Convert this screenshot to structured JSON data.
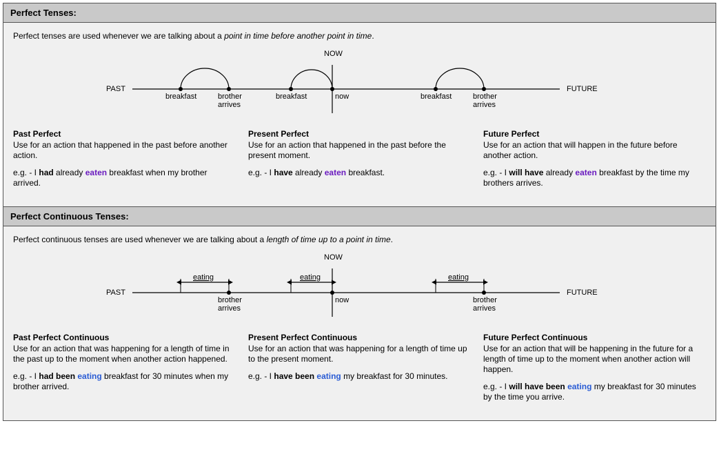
{
  "perfect": {
    "title": "Perfect Tenses:",
    "intro_plain": "Perfect tenses are used whenever we are talking about a ",
    "intro_italic": "point in time before another point in time",
    "intro_end": ".",
    "diagram": {
      "now": "NOW",
      "past": "PAST",
      "future": "FUTURE",
      "seg1_a": "breakfast",
      "seg1_b1": "brother",
      "seg1_b2": "arrives",
      "seg2_a": "breakfast",
      "seg2_b": "now",
      "seg3_a": "breakfast",
      "seg3_b1": "brother",
      "seg3_b2": "arrives"
    },
    "cols": {
      "past": {
        "title": "Past Perfect",
        "desc": "Use for an action that happened in the past before another action.",
        "eg_pre": "e.g. - I ",
        "eg_aux": "had",
        "eg_mid": " already ",
        "eg_verb": "eaten",
        "eg_post": " breakfast when my brother arrived."
      },
      "present": {
        "title": "Present Perfect",
        "desc": "Use for an action that happened in the past before the present moment.",
        "eg_pre": "e.g. - I ",
        "eg_aux": "have",
        "eg_mid": " already ",
        "eg_verb": "eaten",
        "eg_post": " breakfast."
      },
      "future": {
        "title": "Future Perfect",
        "desc": "Use for an action that will happen in the future before another action.",
        "eg_pre": "e.g. - I ",
        "eg_aux": "will have",
        "eg_mid": " already ",
        "eg_verb": "eaten",
        "eg_post": " breakfast by the time my brothers arrives."
      }
    }
  },
  "perfcont": {
    "title": "Perfect Continuous Tenses:",
    "intro_plain": "Perfect continuous tenses are used whenever we are talking about a ",
    "intro_italic": "length of time up to a point in time",
    "intro_end": ".",
    "diagram": {
      "now": "NOW",
      "past": "PAST",
      "future": "FUTURE",
      "span_label": "eating",
      "seg1_b1": "brother",
      "seg1_b2": "arrives",
      "seg2_b": "now",
      "seg3_b1": "brother",
      "seg3_b2": "arrives"
    },
    "cols": {
      "past": {
        "title": "Past Perfect Continuous",
        "desc": "Use for an action that was happening for a length of time in the past up to the moment when another action happened.",
        "eg_pre": "e.g. - I ",
        "eg_aux": "had been ",
        "eg_verb": "eating",
        "eg_post": " breakfast for 30 minutes when my brother arrived."
      },
      "present": {
        "title": "Present Perfect Continuous",
        "desc": "Use for an action that was happening for a length of time up to the present moment.",
        "eg_pre": "e.g. - I ",
        "eg_aux": "have been ",
        "eg_verb": "eating",
        "eg_post": " my breakfast for 30 minutes."
      },
      "future": {
        "title": "Future Perfect Continuous",
        "desc": "Use for an action that will be happening in the future for a length of time up to the moment when another action will happen.",
        "eg_pre": "e.g. - I ",
        "eg_aux": "will have been ",
        "eg_verb": "eating",
        "eg_post": " my breakfast for 30 minutes by the time you arrive."
      }
    }
  }
}
